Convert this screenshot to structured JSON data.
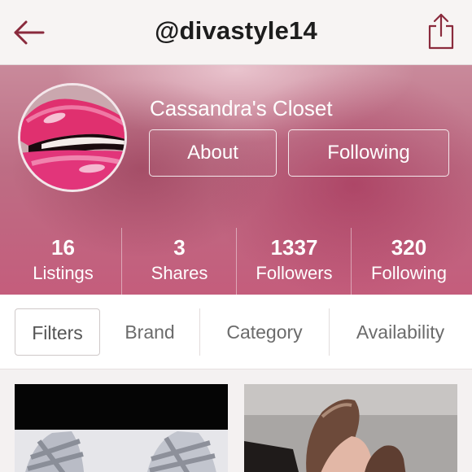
{
  "nav": {
    "username": "@divastyle14",
    "back_icon": "arrow-left-icon",
    "share_icon": "share-icon"
  },
  "profile": {
    "closet_name": "Cassandra's Closet",
    "about_label": "About",
    "following_button_label": "Following",
    "avatar": "pink-lips-photo"
  },
  "stats": [
    {
      "value": "16",
      "label": "Listings"
    },
    {
      "value": "3",
      "label": "Shares"
    },
    {
      "value": "1337",
      "label": "Followers"
    },
    {
      "value": "320",
      "label": "Following"
    }
  ],
  "filters": [
    {
      "label": "Filters",
      "active": true
    },
    {
      "label": "Brand",
      "active": false
    },
    {
      "label": "Category",
      "active": false
    },
    {
      "label": "Availability",
      "active": false
    }
  ],
  "listings": [
    {
      "image": "silver-strappy-heels-photo"
    },
    {
      "image": "bronze-pumps-photo"
    }
  ],
  "colors": {
    "accent": "#8a2a3c",
    "hero": "#c45d7c",
    "nav_bg": "#f7f4f3"
  }
}
